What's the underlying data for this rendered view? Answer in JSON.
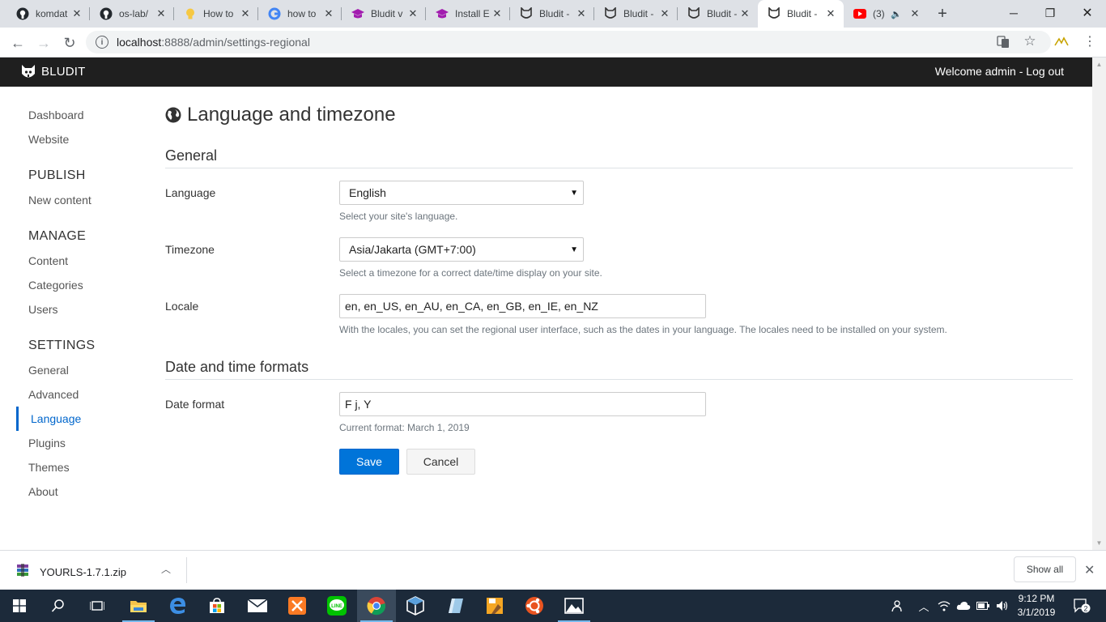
{
  "browser": {
    "tabs": [
      {
        "title": "komdat",
        "icon": "github-icon"
      },
      {
        "title": "os-lab/",
        "icon": "github-icon"
      },
      {
        "title": "How to",
        "icon": "lightbulb-icon"
      },
      {
        "title": "how to",
        "icon": "google-icon"
      },
      {
        "title": "Bludit v",
        "icon": "mortarboard-icon"
      },
      {
        "title": "Install E",
        "icon": "mortarboard-icon"
      },
      {
        "title": "Bludit -",
        "icon": "bludit-icon"
      },
      {
        "title": "Bludit -",
        "icon": "bludit-icon"
      },
      {
        "title": "Bludit -",
        "icon": "bludit-icon"
      },
      {
        "title": "Bludit -",
        "icon": "bludit-icon"
      },
      {
        "title": "(3)",
        "icon": "youtube-icon"
      }
    ],
    "url_host": "localhost",
    "url_path": ":8888/admin/settings-regional"
  },
  "app": {
    "brand": "BLUDIT",
    "welcome": "Welcome admin - Log out"
  },
  "sidebar": {
    "dashboard": "Dashboard",
    "website": "Website",
    "publish_heading": "PUBLISH",
    "new_content": "New content",
    "manage_heading": "MANAGE",
    "content": "Content",
    "categories": "Categories",
    "users": "Users",
    "settings_heading": "SETTINGS",
    "general": "General",
    "advanced": "Advanced",
    "language": "Language",
    "plugins": "Plugins",
    "themes": "Themes",
    "about": "About"
  },
  "page": {
    "title": "Language and timezone",
    "general_heading": "General",
    "language_label": "Language",
    "language_value": "English",
    "language_help": "Select your site's language.",
    "timezone_label": "Timezone",
    "timezone_value": "Asia/Jakarta (GMT+7:00)",
    "timezone_help": "Select a timezone for a correct date/time display on your site.",
    "locale_label": "Locale",
    "locale_value": "en, en_US, en_AU, en_CA, en_GB, en_IE, en_NZ",
    "locale_help": "With the locales, you can set the regional user interface, such as the dates in your language. The locales need to be installed on your system.",
    "datetime_heading": "Date and time formats",
    "date_format_label": "Date format",
    "date_format_value": "F j, Y",
    "date_format_help": "Current format: March 1, 2019",
    "save": "Save",
    "cancel": "Cancel"
  },
  "downloads": {
    "file": "YOURLS-1.7.1.zip",
    "show_all": "Show all"
  },
  "taskbar": {
    "time": "9:12 PM",
    "date": "3/1/2019",
    "notifications": "2"
  },
  "colors": {
    "accent": "#0074d9",
    "navbar": "#1f1f1f",
    "taskbar": "#1c2a3a"
  }
}
